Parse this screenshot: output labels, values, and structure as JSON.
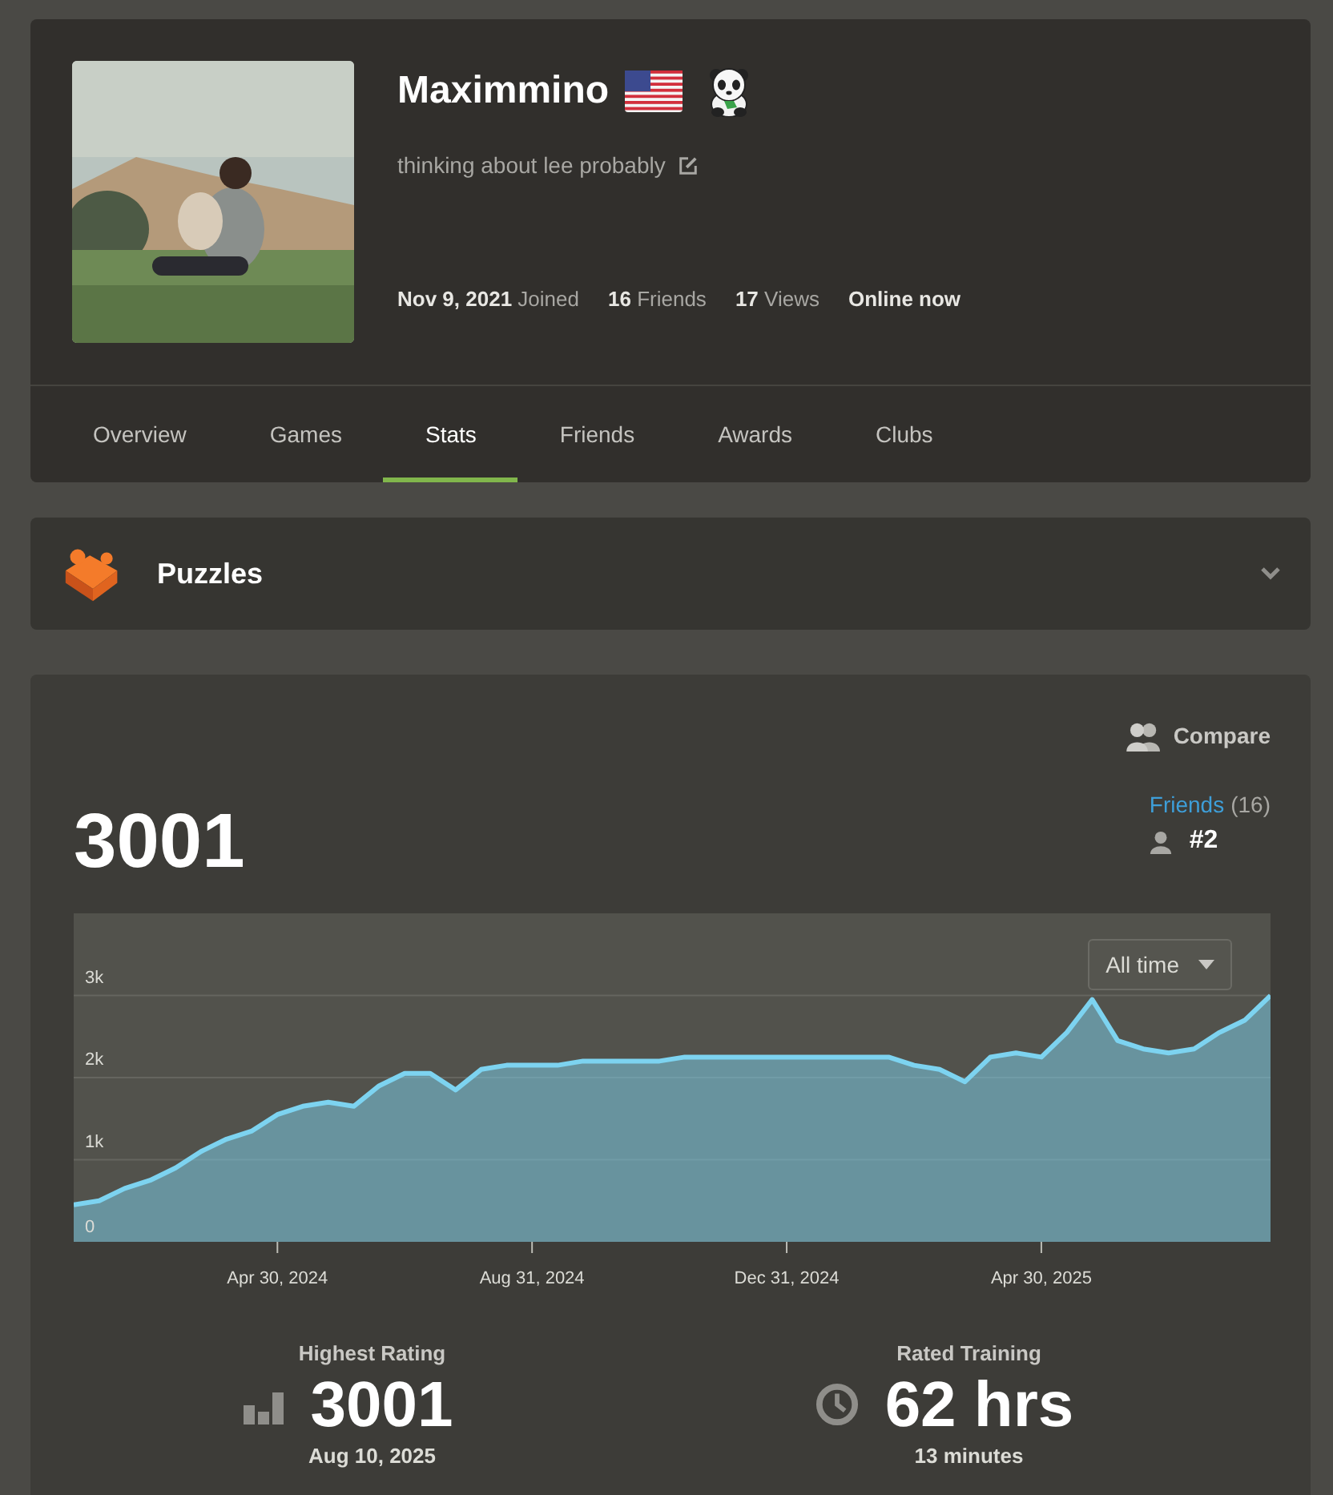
{
  "profile": {
    "name": "Maximmino",
    "status_text": "thinking about lee probably",
    "joined_date": "Nov 9, 2021",
    "joined_label": "Joined",
    "friends_count": "16",
    "friends_label": "Friends",
    "views_count": "17",
    "views_label": "Views",
    "online": "Online now"
  },
  "tabs": [
    {
      "label": "Overview",
      "selected": false
    },
    {
      "label": "Games",
      "selected": false
    },
    {
      "label": "Stats",
      "selected": true
    },
    {
      "label": "Friends",
      "selected": false
    },
    {
      "label": "Awards",
      "selected": false
    },
    {
      "label": "Clubs",
      "selected": false
    }
  ],
  "section": {
    "title": "Puzzles"
  },
  "stats": {
    "compare_label": "Compare",
    "rating": "3001",
    "friends_link": "Friends",
    "friends_count": "(16)",
    "rank": "#2",
    "period_select": "All time",
    "chart_data": {
      "type": "area",
      "categories": [
        null,
        null,
        null,
        null,
        null,
        null,
        null,
        null,
        "Apr 30, 2024",
        null,
        null,
        null,
        null,
        null,
        null,
        null,
        null,
        null,
        "Aug 31, 2024",
        null,
        null,
        null,
        null,
        null,
        null,
        null,
        null,
        null,
        "Dec 31, 2024",
        null,
        null,
        null,
        null,
        null,
        null,
        null,
        null,
        null,
        "Apr 30, 2025",
        null,
        null,
        null,
        null,
        null,
        null,
        null,
        null,
        null
      ],
      "series": [
        {
          "color": "#7dd3f0",
          "values": [
            450,
            500,
            650,
            750,
            900,
            1100,
            1250,
            1350,
            1550,
            1650,
            1700,
            1650,
            1900,
            2050,
            2050,
            1850,
            2100,
            2150,
            2150,
            2150,
            2200,
            2200,
            2200,
            2200,
            2250,
            2250,
            2250,
            2250,
            2250,
            2250,
            2250,
            2250,
            2250,
            2150,
            2100,
            1950,
            2250,
            2300,
            2250,
            2550,
            2950,
            2450,
            2350,
            2300,
            2350,
            2550,
            2700,
            3000
          ]
        }
      ],
      "ylim": [
        0,
        4000
      ],
      "grid": true,
      "yticks": [
        {
          "value": 0,
          "label": "0"
        },
        {
          "value": 1000,
          "label": "1k"
        },
        {
          "value": 2000,
          "label": "2k"
        },
        {
          "value": 3000,
          "label": "3k"
        }
      ]
    },
    "highest": {
      "label": "Highest Rating",
      "value": "3001",
      "date": "Aug 10, 2025"
    },
    "training": {
      "label": "Rated Training",
      "value": "62 hrs",
      "sub": "13 minutes"
    }
  }
}
